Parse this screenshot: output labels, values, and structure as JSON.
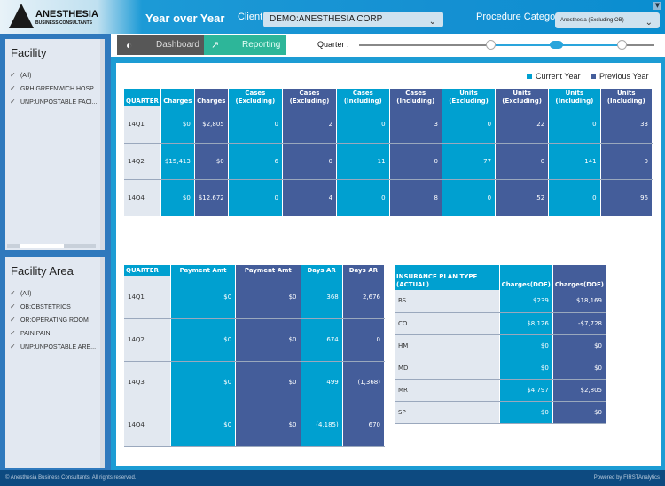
{
  "header": {
    "logo_line1": "ANESTHESIA",
    "logo_line2": "BUSINESS CONSULTANTS",
    "title": "Year over Year",
    "client_label": "Client",
    "client_value": "DEMO:ANESTHESIA CORP",
    "procedure_label": "Procedure Category",
    "procedure_value": "Anesthesia (Excluding OB)"
  },
  "toolbar": {
    "dashboard": "Dashboard",
    "reporting": "Reporting",
    "quarter_label": "Quarter :"
  },
  "sidebar": {
    "facility": {
      "title": "Facility",
      "items": [
        "(All)",
        "GRH:GREENWICH HOSP...",
        "UNP:UNPOSTABLE FACI..."
      ]
    },
    "facility_area": {
      "title": "Facility Area",
      "items": [
        "(All)",
        "OB:OBSTETRICS",
        "OR:OPERATING ROOM",
        "PAIN:PAIN",
        "UNP:UNPOSTABLE ARE..."
      ]
    }
  },
  "legend": {
    "current": "Current Year",
    "previous": "Previous Year",
    "current_color": "#00a0d0",
    "previous_color": "#445d9a"
  },
  "table1": {
    "headers": [
      "QUARTER",
      "Charges",
      "Charges",
      "Cases (Excluding)",
      "Cases (Excluding)",
      "Cases (Including)",
      "Cases (Including)",
      "Units (Excluding)",
      "Units (Excluding)",
      "Units (Including)",
      "Units (Including)"
    ],
    "rows": [
      [
        "14Q1",
        "$0",
        "$2,805",
        "0",
        "2",
        "0",
        "3",
        "0",
        "22",
        "0",
        "33"
      ],
      [
        "14Q2",
        "$15,413",
        "$0",
        "6",
        "0",
        "11",
        "0",
        "77",
        "0",
        "141",
        "0"
      ],
      [
        "14Q4",
        "$0",
        "$12,672",
        "0",
        "4",
        "0",
        "8",
        "0",
        "52",
        "0",
        "96"
      ]
    ]
  },
  "table2": {
    "headers": [
      "QUARTER",
      "Payment Amt",
      "Payment Amt",
      "Days AR",
      "Days AR"
    ],
    "rows": [
      [
        "14Q1",
        "$0",
        "$0",
        "368",
        "2,676"
      ],
      [
        "14Q2",
        "$0",
        "$0",
        "674",
        "0"
      ],
      [
        "14Q3",
        "$0",
        "$0",
        "499",
        "(1,368)"
      ],
      [
        "14Q4",
        "$0",
        "$0",
        "(4,185)",
        "670"
      ]
    ]
  },
  "table3": {
    "headers": [
      "INSURANCE PLAN TYPE (ACTUAL)",
      "Charges(DOE)",
      "Charges(DOE)"
    ],
    "rows": [
      [
        "BS",
        "$239",
        "$18,169"
      ],
      [
        "CO",
        "$8,126",
        "-$7,728"
      ],
      [
        "HM",
        "$0",
        "$0"
      ],
      [
        "MD",
        "$0",
        "$0"
      ],
      [
        "MR",
        "$4,797",
        "$2,805"
      ],
      [
        "SP",
        "$0",
        "$0"
      ]
    ]
  },
  "footer": {
    "copyright": "© Anesthesia Business Consultants. All rights reserved.",
    "powered": "Powered by FIRSTAnalytics"
  }
}
